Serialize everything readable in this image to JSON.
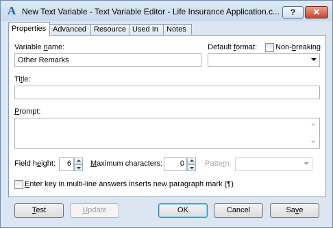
{
  "window": {
    "title": "New Text Variable - Text Variable Editor - Life Insurance Application.c...",
    "app_icon_glyph": "A",
    "help_glyph": "?",
    "close_glyph": "✕"
  },
  "tabs": [
    {
      "label": "Properties",
      "active": true
    },
    {
      "label": "Advanced",
      "active": false
    },
    {
      "label": "Resource",
      "active": false
    },
    {
      "label": "Used In",
      "active": false
    },
    {
      "label": "Notes",
      "active": false
    }
  ],
  "properties": {
    "variable_name": {
      "label_pre": "Variable ",
      "label_u": "n",
      "label_post": "ame:",
      "value": "Other Remarks"
    },
    "default_format": {
      "label_pre": "Default ",
      "label_u": "f",
      "label_post": "ormat:",
      "value": ""
    },
    "non_breaking": {
      "label_pre": "Non-",
      "label_u": "b",
      "label_post": "reaking",
      "checked": false
    },
    "title": {
      "label_pre": "Ti",
      "label_u": "t",
      "label_post": "le:",
      "value": ""
    },
    "prompt": {
      "label_pre": "",
      "label_u": "P",
      "label_post": "rompt:",
      "value": ""
    },
    "field_height": {
      "label_pre": "Field h",
      "label_u": "e",
      "label_post": "ight:",
      "value": "6"
    },
    "max_chars": {
      "label_pre": "",
      "label_u": "M",
      "label_post": "aximum characters:",
      "value": "0"
    },
    "pattern": {
      "label_pre": "Patte",
      "label_u": "r",
      "label_post": "n:",
      "value": ""
    },
    "enter_key": {
      "label_pre": "",
      "label_u": "E",
      "label_post": "nter key in multi-line answers inserts new paragraph mark (¶)",
      "checked": false
    }
  },
  "buttons": {
    "test": {
      "pre": "",
      "u": "T",
      "post": "est"
    },
    "update": {
      "pre": "",
      "u": "U",
      "post": "pdate"
    },
    "ok": {
      "label": "OK"
    },
    "cancel": {
      "label": "Cancel"
    },
    "save": {
      "pre": "Sa",
      "u": "v",
      "post": "e"
    }
  }
}
